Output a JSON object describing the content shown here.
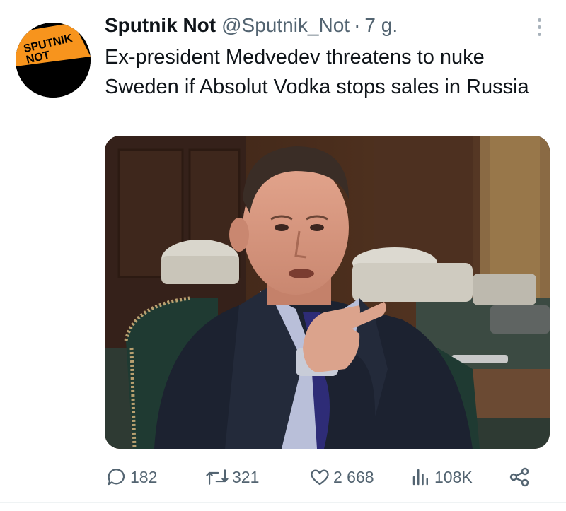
{
  "tweet": {
    "display_name": "Sputnik Not",
    "handle": "@Sputnik_Not",
    "separator": "·",
    "time": "7 g.",
    "text": "Ex-president Medvedev threatens to nuke Sweden if Absolut Vodka stops sales in Russia",
    "avatar_text": {
      "line1": "SPUTNIK",
      "line2": "NOT"
    },
    "avatar_colors": {
      "background": "#000000",
      "accent": "#f7941d"
    }
  },
  "actions": {
    "replies": "182",
    "retweets": "321",
    "likes": "2 668",
    "views": "108K"
  },
  "icons": {
    "reply": "speech-bubble-icon",
    "retweet": "retweet-arrows-icon",
    "like": "heart-icon",
    "views": "bar-chart-icon",
    "share": "share-nodes-icon",
    "more": "vertical-ellipsis-icon"
  },
  "colors": {
    "text": "#0f1419",
    "secondary": "#536471"
  }
}
